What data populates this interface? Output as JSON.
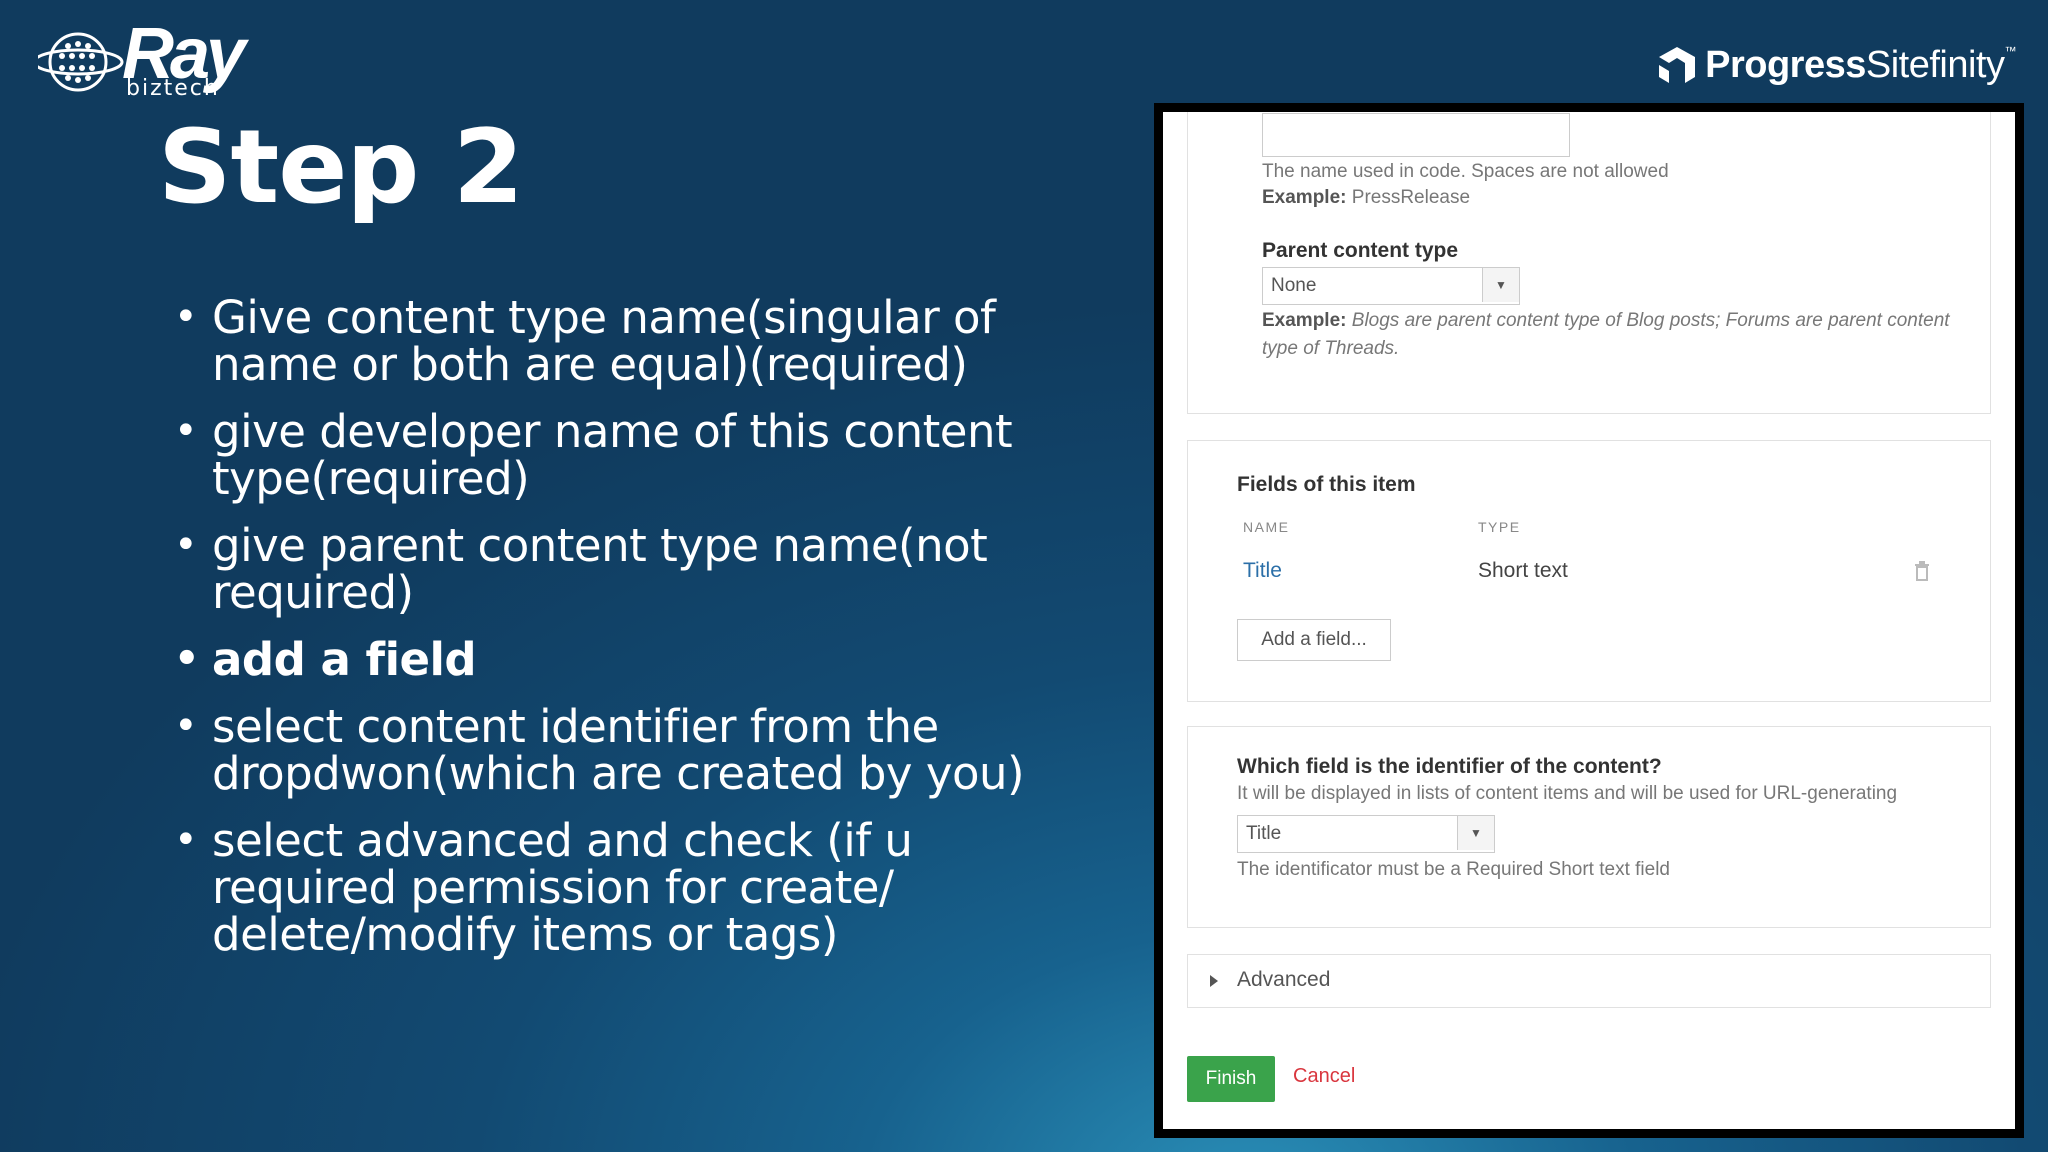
{
  "logo": {
    "name": "Ray",
    "sub": "biztech"
  },
  "brand": {
    "name_bold": "Progress",
    "name_light": "Sitefinity",
    "trademark": "™"
  },
  "slide": {
    "title": "Step 2",
    "bullets": [
      {
        "text": "Give content type name(singular of name or both are equal)(required)",
        "bold": false
      },
      {
        "text": "give developer name of this content type(required)",
        "bold": false
      },
      {
        "text": "give parent content type name(not required)",
        "bold": false
      },
      {
        "text": "add a field",
        "bold": true
      },
      {
        "text": "select content identifier from the dropdwon(which are created by you)",
        "bold": false
      },
      {
        "text": "select advanced and check (if u required permission for create/ delete/modify items or tags)",
        "bold": false
      }
    ]
  },
  "form": {
    "dev_name": {
      "value": "",
      "help": "The name used in code. Spaces are not allowed",
      "example_label": "Example:",
      "example_value": "PressRelease"
    },
    "parent": {
      "label": "Parent content type",
      "selected": "None",
      "example_label": "Example:",
      "example_text": "Blogs are parent content type of Blog posts; Forums are parent content type of Threads."
    },
    "fields": {
      "heading": "Fields of this item",
      "col_name": "NAME",
      "col_type": "TYPE",
      "rows": [
        {
          "name": "Title",
          "type": "Short text"
        }
      ],
      "add_label": "Add a field..."
    },
    "identifier": {
      "question": "Which field is the identifier of the content?",
      "help": "It will be displayed in lists of content items and will be used for URL-generating",
      "selected": "Title",
      "note": "The identificator must be a Required Short text field"
    },
    "advanced_label": "Advanced",
    "finish_label": "Finish",
    "cancel_label": "Cancel"
  },
  "colors": {
    "finish": "#3aa34b",
    "cancel": "#d9363e",
    "link": "#2b6fa8",
    "background": "#124a72"
  }
}
